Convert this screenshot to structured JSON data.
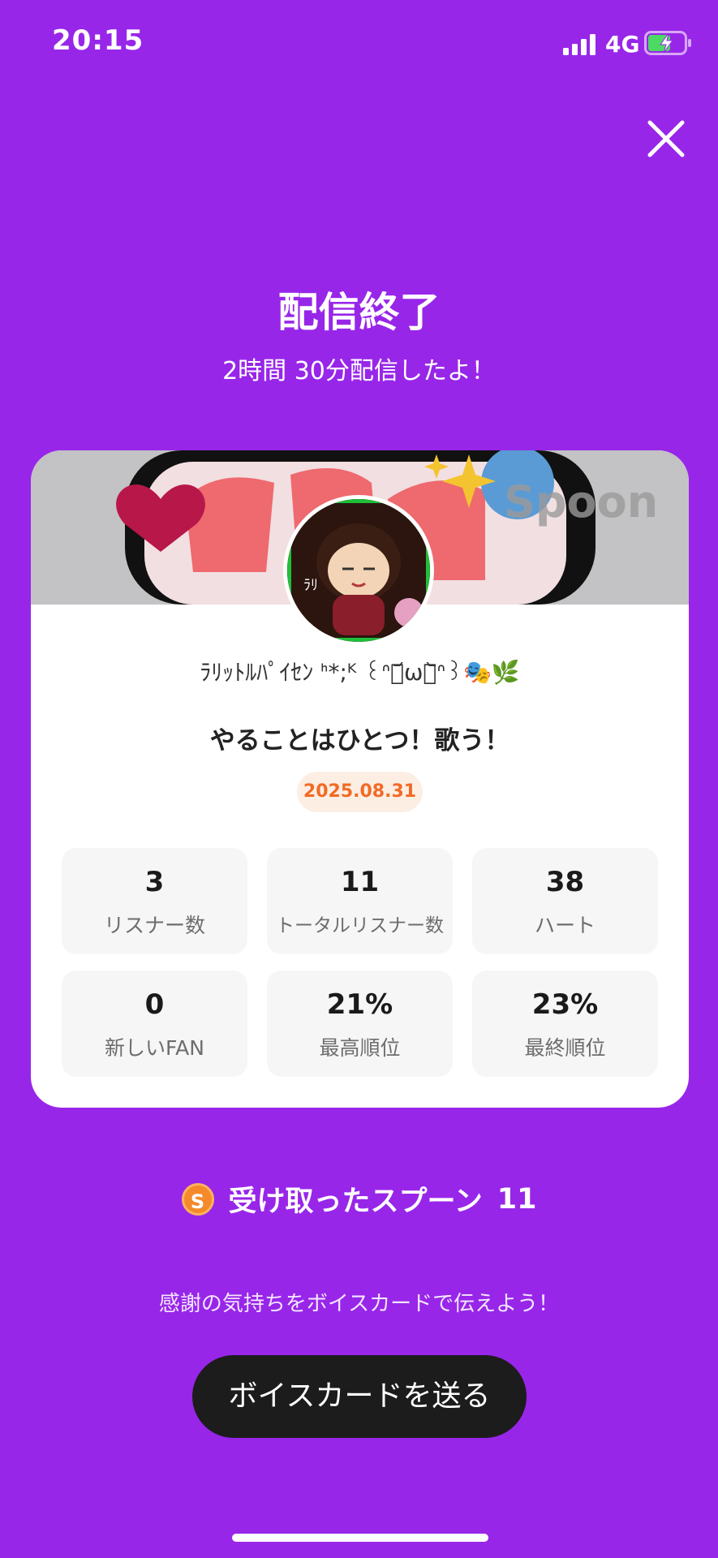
{
  "status_bar": {
    "time": "20:15",
    "network": "4G"
  },
  "header": {
    "title": "配信終了",
    "subtitle": "2時間 30分配信したよ！"
  },
  "card": {
    "banner_watermark": "Spoon",
    "username": "ﾗﾘｯﾄﾙﾊﾟｲｾﾝ ᑋ*;ᴷ ꒰ᐢ๑᷄ω๑᷅ᐢ꒱🎭🌿",
    "live_title": "やることはひとつ！歌う！",
    "date": "2025.08.31",
    "stats": [
      {
        "value": "3",
        "label": "リスナー数"
      },
      {
        "value": "11",
        "label": "トータルリスナー数"
      },
      {
        "value": "38",
        "label": "ハート"
      },
      {
        "value": "0",
        "label": "新しいFAN"
      },
      {
        "value": "21%",
        "label": "最高順位"
      },
      {
        "value": "23%",
        "label": "最終順位"
      }
    ]
  },
  "spoons": {
    "icon": "S",
    "label": "受け取ったスプーン",
    "count": "11"
  },
  "footer": {
    "thanks_text": "感謝の気持ちをボイスカードで伝えよう！",
    "voice_card_button": "ボイスカードを送る"
  },
  "colors": {
    "background": "#9826e9",
    "accent": "#f26a25",
    "button": "#1c1c1c"
  }
}
